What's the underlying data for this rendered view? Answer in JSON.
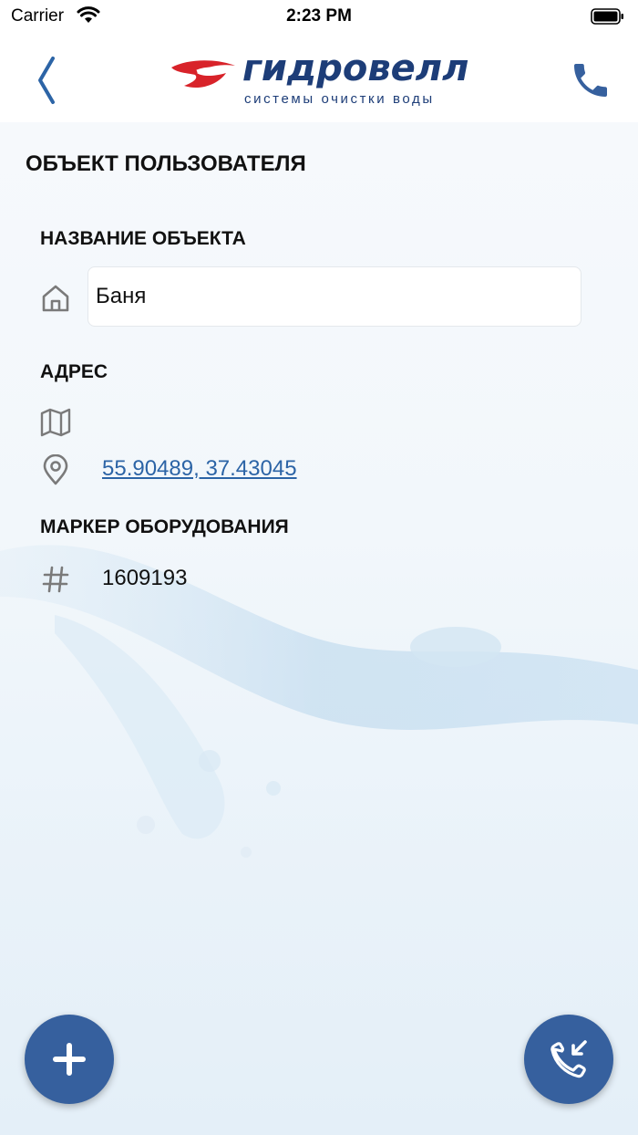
{
  "status_bar": {
    "carrier": "Carrier",
    "time": "2:23 PM"
  },
  "nav": {
    "logo_name": "гидровелл",
    "logo_tagline": "системы очистки воды",
    "back_icon": "chevron-left-icon",
    "phone_icon": "phone-icon"
  },
  "page": {
    "title": "ОБЪЕКТ ПОЛЬЗОВАТЕЛЯ",
    "name_label": "НАЗВАНИЕ ОБЪЕКТА",
    "name_value": "Баня",
    "address_label": "АДРЕС",
    "coordinates": "55.90489, 37.43045",
    "marker_label": "МАРКЕР ОБОРУДОВАНИЯ",
    "marker_value": "1609193"
  },
  "fabs": {
    "add_icon": "plus-icon",
    "call_icon": "incoming-call-icon"
  },
  "colors": {
    "accent": "#36609e",
    "link": "#2c64a6",
    "brand": "#1d3d78",
    "logo_red": "#d8232a"
  }
}
